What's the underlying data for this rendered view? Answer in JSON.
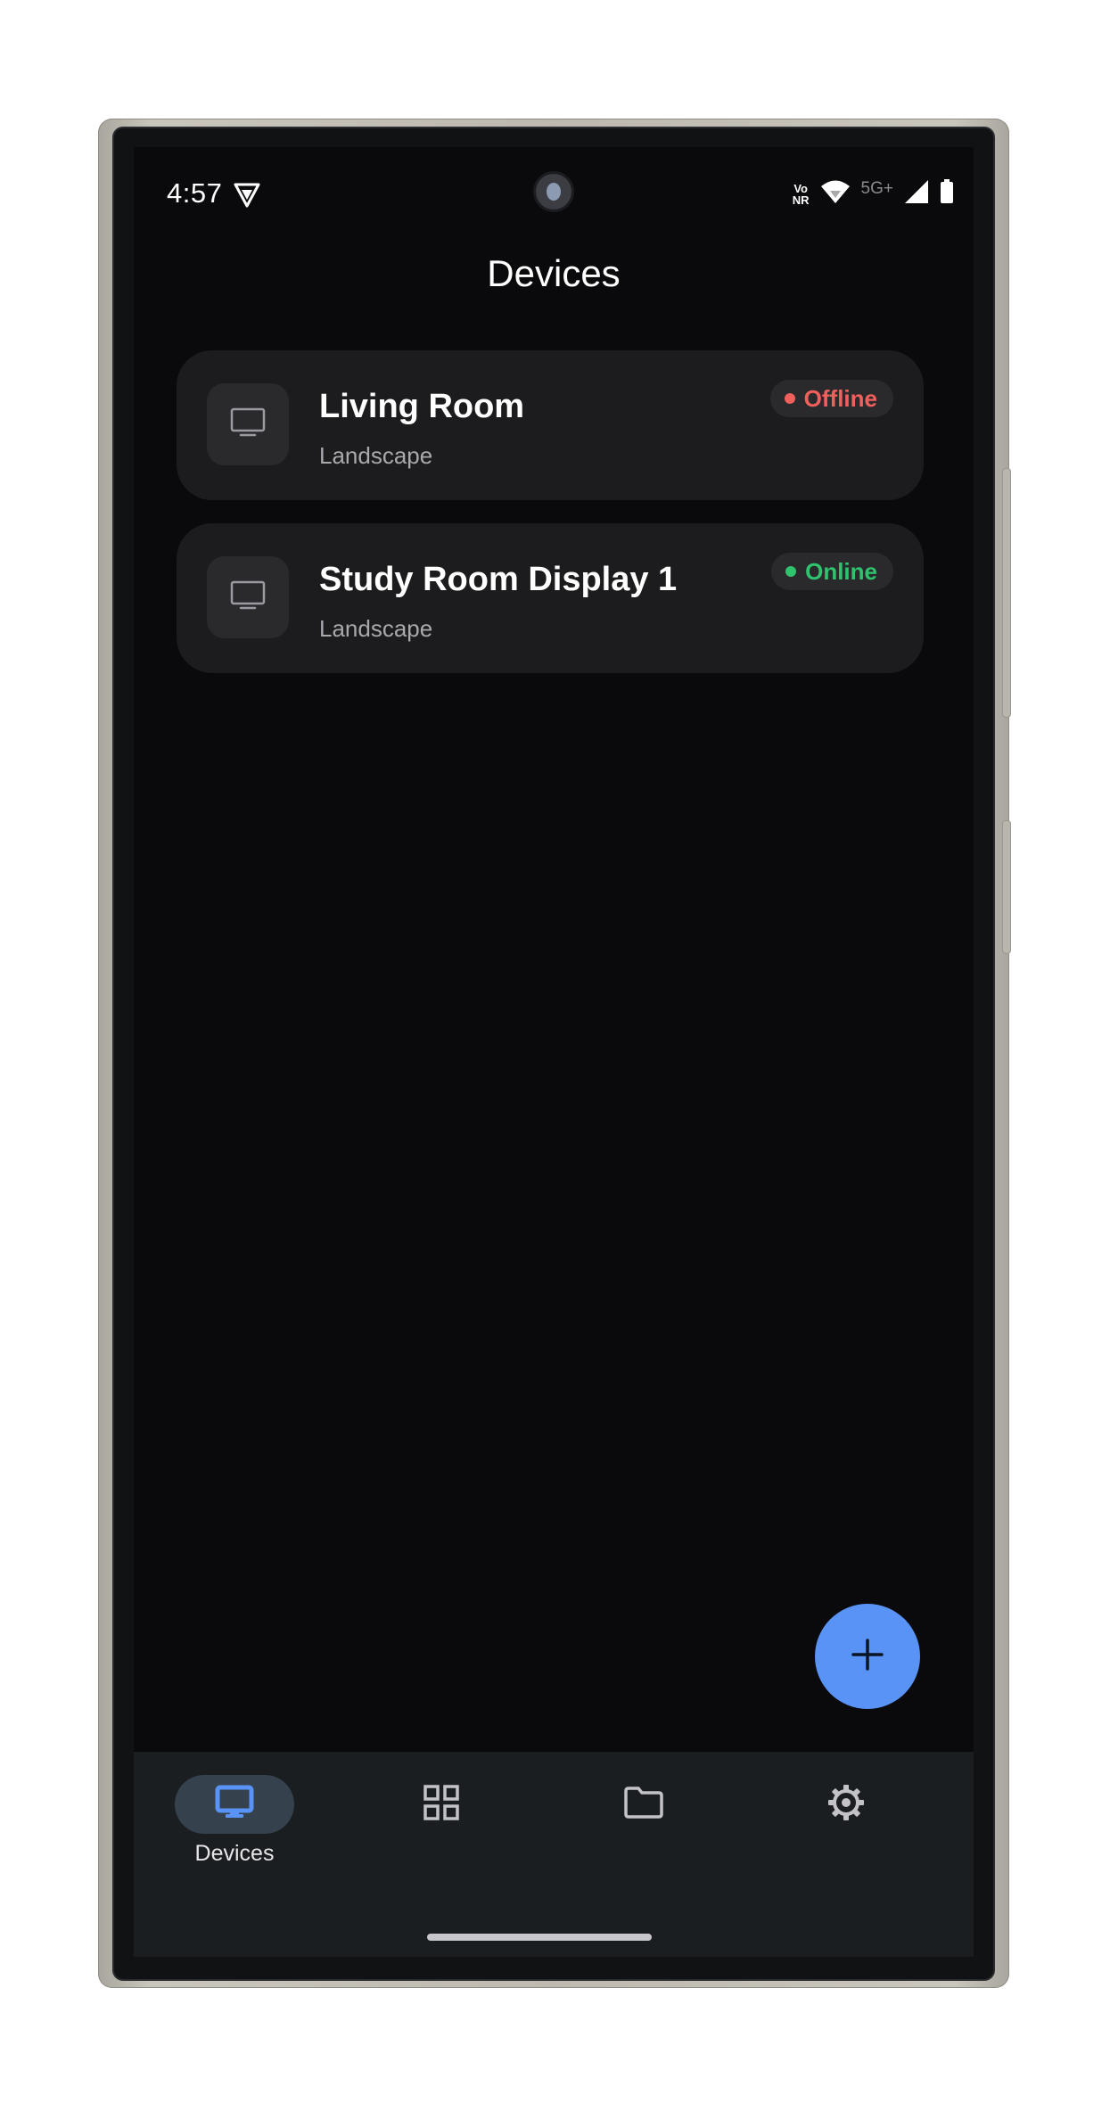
{
  "status_bar": {
    "time": "4:57",
    "volte_top": "Vo",
    "volte_bottom": "NR",
    "network": "5G+"
  },
  "header": {
    "title": "Devices"
  },
  "devices": [
    {
      "name": "Living Room",
      "orientation": "Landscape",
      "status": "Offline",
      "status_color": "#f0605d"
    },
    {
      "name": "Study Room Display 1",
      "orientation": "Landscape",
      "status": "Online",
      "status_color": "#2fc36e"
    }
  ],
  "fab": {
    "icon": "plus-icon"
  },
  "bottom_nav": {
    "items": [
      {
        "icon": "monitor-icon",
        "label": "Devices",
        "active": true
      },
      {
        "icon": "grid-icon",
        "label": "",
        "active": false
      },
      {
        "icon": "folder-icon",
        "label": "",
        "active": false
      },
      {
        "icon": "gear-icon",
        "label": "",
        "active": false
      }
    ]
  },
  "colors": {
    "accent": "#5a93f6",
    "background": "#0a0a0c",
    "card": "#1c1c1f",
    "nav_background": "#1b1e21"
  }
}
